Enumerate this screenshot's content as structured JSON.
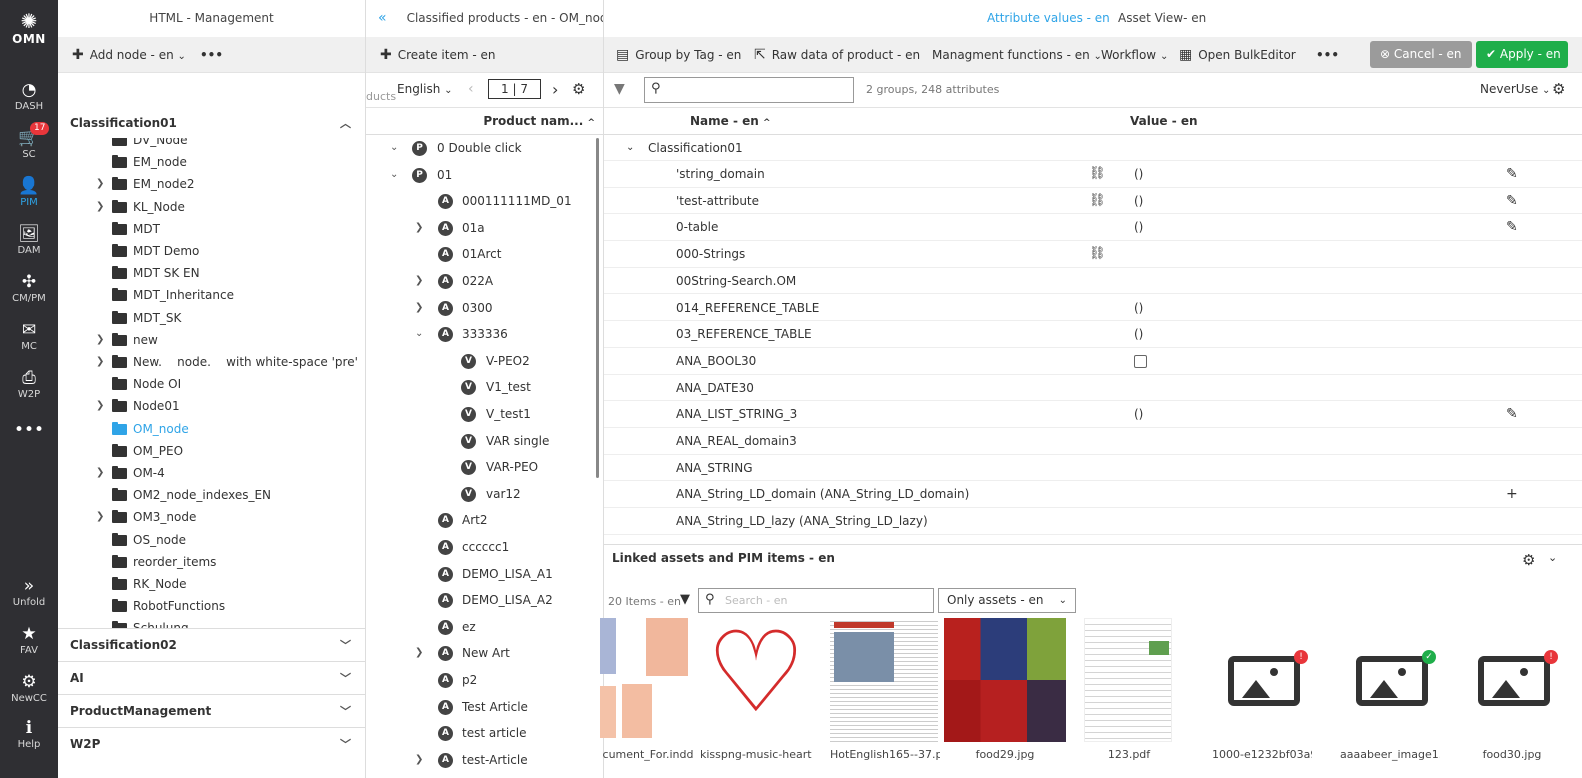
{
  "app": {
    "logo": "OMN"
  },
  "rail": [
    {
      "label": "DASH",
      "icon": "dashboard-icon",
      "glyph": "◔"
    },
    {
      "label": "SC",
      "icon": "cart-icon",
      "glyph": "🛒",
      "badge": "17"
    },
    {
      "label": "PIM",
      "icon": "user-icon",
      "glyph": "👤",
      "active": true
    },
    {
      "label": "DAM",
      "icon": "images-icon",
      "glyph": "🖼"
    },
    {
      "label": "CM/PM",
      "icon": "network-icon",
      "glyph": "✣"
    },
    {
      "label": "MC",
      "icon": "mail-icon",
      "glyph": "✉"
    },
    {
      "label": "W2P",
      "icon": "print-icon",
      "glyph": "⎙"
    },
    {
      "label": "",
      "icon": "more-icon",
      "glyph": "•••"
    }
  ],
  "rail_bottom": [
    {
      "label": "Unfold",
      "icon": "unfold-icon",
      "glyph": "»"
    },
    {
      "label": "FAV",
      "icon": "star-icon",
      "glyph": "★"
    },
    {
      "label": "NewCC",
      "icon": "gear-icon",
      "glyph": "⚙"
    },
    {
      "label": "Help",
      "icon": "info-icon",
      "glyph": "ℹ"
    }
  ],
  "panel1": {
    "title": "HTML - Management",
    "add_node": "Add node - en",
    "more": "•••",
    "section1": "Classification01",
    "tree": [
      {
        "label": "DV_Node",
        "arrow": false
      },
      {
        "label": "EM_node",
        "arrow": false
      },
      {
        "label": "EM_node2",
        "arrow": true
      },
      {
        "label": "KL_Node",
        "arrow": true
      },
      {
        "label": "MDT",
        "arrow": false
      },
      {
        "label": "MDT Demo",
        "arrow": false
      },
      {
        "label": "MDT SK EN",
        "arrow": false
      },
      {
        "label": "MDT_Inheritance",
        "arrow": false
      },
      {
        "label": "MDT_SK",
        "arrow": false
      },
      {
        "label": "new",
        "arrow": true
      },
      {
        "label": "New.    node.    with white-space 'pre'",
        "arrow": true
      },
      {
        "label": "Node OI",
        "arrow": false
      },
      {
        "label": "Node01",
        "arrow": true
      },
      {
        "label": "OM_node",
        "arrow": false,
        "selected": true
      },
      {
        "label": "OM_PEO",
        "arrow": false
      },
      {
        "label": "OM-4",
        "arrow": true
      },
      {
        "label": "OM2_node_indexes_EN",
        "arrow": false
      },
      {
        "label": "OM3_node",
        "arrow": true
      },
      {
        "label": "OS_node",
        "arrow": false
      },
      {
        "label": "reorder_items",
        "arrow": false
      },
      {
        "label": "RK_Node",
        "arrow": false
      },
      {
        "label": "RobotFunctions",
        "arrow": false
      },
      {
        "label": "Schulung",
        "arrow": false
      }
    ],
    "sections": [
      "Classification02",
      "AI",
      "ProductManagement",
      "W2P"
    ]
  },
  "panel2": {
    "title": "Classified products - en - OM_node",
    "create_item": "Create item - en",
    "lang_prefix": "ducts",
    "language": "English",
    "page": "1 | 7",
    "col_header": "Product nam...",
    "rows": [
      {
        "label": "0 Double click",
        "badge": "P",
        "level": 0,
        "arrow": "down"
      },
      {
        "label": "01",
        "badge": "P",
        "level": 0,
        "arrow": "down"
      },
      {
        "label": "000111111MD_01",
        "badge": "A",
        "level": 1,
        "arrow": ""
      },
      {
        "label": "01a",
        "badge": "A",
        "level": 1,
        "arrow": "right"
      },
      {
        "label": "01Arct",
        "badge": "A",
        "level": 1,
        "arrow": ""
      },
      {
        "label": "022A",
        "badge": "A",
        "level": 1,
        "arrow": "right"
      },
      {
        "label": "0300",
        "badge": "A",
        "level": 1,
        "arrow": "right"
      },
      {
        "label": "333336",
        "badge": "A",
        "level": 1,
        "arrow": "down"
      },
      {
        "label": "V-PEO2",
        "badge": "V",
        "level": 2,
        "arrow": ""
      },
      {
        "label": "V1_test",
        "badge": "V",
        "level": 2,
        "arrow": ""
      },
      {
        "label": "V_test1",
        "badge": "V",
        "level": 2,
        "arrow": ""
      },
      {
        "label": "VAR single",
        "badge": "V",
        "level": 2,
        "arrow": ""
      },
      {
        "label": "VAR-PEO",
        "badge": "V",
        "level": 2,
        "arrow": ""
      },
      {
        "label": "var12",
        "badge": "V",
        "level": 2,
        "arrow": ""
      },
      {
        "label": "Art2",
        "badge": "A",
        "level": 1,
        "arrow": ""
      },
      {
        "label": "cccccc1",
        "badge": "A",
        "level": 1,
        "arrow": ""
      },
      {
        "label": "DEMO_LISA_A1",
        "badge": "A",
        "level": 1,
        "arrow": ""
      },
      {
        "label": "DEMO_LISA_A2",
        "badge": "A",
        "level": 1,
        "arrow": ""
      },
      {
        "label": "ez",
        "badge": "A",
        "level": 1,
        "arrow": ""
      },
      {
        "label": "New Art",
        "badge": "A",
        "level": 1,
        "arrow": "right"
      },
      {
        "label": "p2",
        "badge": "A",
        "level": 1,
        "arrow": ""
      },
      {
        "label": "Test Article",
        "badge": "A",
        "level": 1,
        "arrow": ""
      },
      {
        "label": "test article",
        "badge": "A",
        "level": 1,
        "arrow": ""
      },
      {
        "label": "test-Article",
        "badge": "A",
        "level": 1,
        "arrow": "right"
      }
    ]
  },
  "panel3": {
    "tabs": [
      "Attribute values - en",
      "Asset View- en"
    ],
    "toolbar": {
      "group": "Group by Tag - en",
      "raw": "Raw data of product - en",
      "mgmt": "Managment functions - en",
      "workflow": "Workflow",
      "bulk": "Open BulkEditor",
      "more": "•••",
      "cancel": "Cancel - en",
      "apply": "Apply - en"
    },
    "filter_summary": "2 groups, 248 attributes",
    "never_use": "NeverUse",
    "col_name": "Name - en",
    "col_value": "Value - en",
    "group": "Classification01",
    "attributes": [
      {
        "name": "'string_domain",
        "value": "()",
        "unlink": true,
        "action": "✎"
      },
      {
        "name": "'test-attribute",
        "value": "()",
        "unlink": true,
        "action": "✎"
      },
      {
        "name": "0-table",
        "value": "()",
        "unlink": false,
        "action": "✎"
      },
      {
        "name": "000-Strings",
        "value": "",
        "unlink": true,
        "action": ""
      },
      {
        "name": "00String-Search.OM",
        "value": "",
        "unlink": false,
        "action": ""
      },
      {
        "name": "014_REFERENCE_TABLE",
        "value": "()",
        "unlink": false,
        "action": ""
      },
      {
        "name": "03_REFERENCE_TABLE",
        "value": "()",
        "unlink": false,
        "action": ""
      },
      {
        "name": "ANA_BOOL30",
        "value": "",
        "checkbox": true,
        "unlink": false,
        "action": ""
      },
      {
        "name": "ANA_DATE30",
        "value": "",
        "unlink": false,
        "action": ""
      },
      {
        "name": "ANA_LIST_STRING_3",
        "value": "()",
        "unlink": false,
        "action": "✎"
      },
      {
        "name": "ANA_REAL_domain3",
        "value": "",
        "unlink": false,
        "action": ""
      },
      {
        "name": "ANA_STRING",
        "value": "",
        "unlink": false,
        "action": ""
      },
      {
        "name": "ANA_String_LD_domain (ANA_String_LD_domain)",
        "value": "",
        "unlink": false,
        "action": "+"
      },
      {
        "name": "ANA_String_LD_lazy (ANA_String_LD_lazy)",
        "value": "",
        "unlink": false,
        "action": ""
      }
    ],
    "linked": {
      "title": "Linked assets and PIM items - en",
      "count": "20 Items - en",
      "search_placeholder": "Search - en",
      "only": "Only assets - en",
      "assets": [
        {
          "caption": "cument_For.indd",
          "kind": "fashion"
        },
        {
          "caption": "kisspng-music-heart...",
          "kind": "heart"
        },
        {
          "caption": "HotEnglish165--37.pdf",
          "kind": "magazine"
        },
        {
          "caption": "food29.jpg",
          "kind": "berries"
        },
        {
          "caption": "123.pdf",
          "kind": "doc"
        },
        {
          "caption": "1000-e1232bf03a99...",
          "kind": "placeholder",
          "status": "!"
        },
        {
          "caption": "aaaabeer_image1.w...",
          "kind": "placeholder",
          "status": "✓"
        },
        {
          "caption": "food30.jpg",
          "kind": "placeholder",
          "status": "!"
        }
      ]
    }
  },
  "colors": {
    "accent": "#2fa4e7",
    "apply": "#1fae4a",
    "cancel": "#999999",
    "rail": "#2f2f33",
    "badge_red": "#e8363b"
  }
}
